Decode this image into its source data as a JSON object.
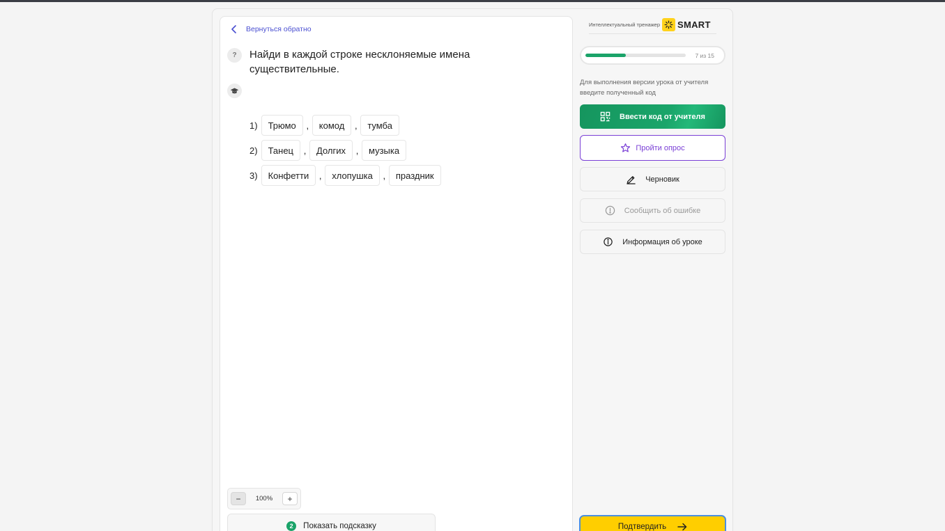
{
  "nav": {
    "back_label": "Вернуться обратно"
  },
  "task": {
    "help_mark": "?",
    "title": "Найди в каждой строке несклоняемые имена существительные.",
    "rows": [
      {
        "num": "1)",
        "words": [
          "Трюмо",
          "комод",
          "тумба"
        ]
      },
      {
        "num": "2)",
        "words": [
          "Танец",
          "Долгих",
          "музыка"
        ]
      },
      {
        "num": "3)",
        "words": [
          "Конфетти",
          "хлопушка",
          "праздник"
        ]
      }
    ],
    "separator": ","
  },
  "zoom": {
    "minus": "−",
    "value": "100%",
    "plus": "+"
  },
  "hint": {
    "count": "2",
    "label": "Показать подсказку"
  },
  "sidebar": {
    "brand_caption": "Интеллектуальный тренажер",
    "brand_name": "SMART",
    "progress": {
      "current": 7,
      "total": 15,
      "text": "7 из 15",
      "fraction": 0.4
    },
    "teacher_note": "Для выполнения версии урока от учителя введите полученный код",
    "buttons": {
      "teacher_code": "Ввести код от учителя",
      "survey": "Пройти опрос",
      "draft": "Черновик",
      "report_error": "Сообщить об ошибке",
      "lesson_info": "Информация об уроке"
    },
    "confirm": "Подтвердить"
  },
  "colors": {
    "accent_green": "#1aa369",
    "accent_purple": "#7a3fd6",
    "link_blue": "#4a4fd1",
    "confirm_yellow": "#ffce00"
  }
}
